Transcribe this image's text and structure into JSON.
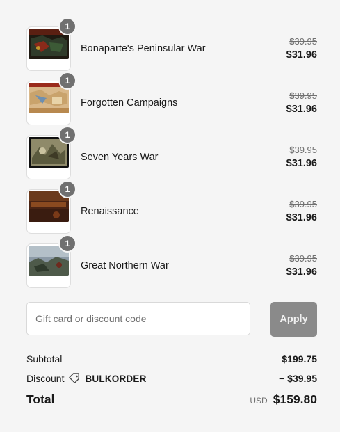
{
  "items": [
    {
      "name": "Bonaparte's Peninsular War",
      "quantity": "1",
      "original_price": "$39.95",
      "price": "$31.96",
      "cover": "cover-peninsular"
    },
    {
      "name": "Forgotten Campaigns",
      "quantity": "1",
      "original_price": "$39.95",
      "price": "$31.96",
      "cover": "cover-forgotten"
    },
    {
      "name": "Seven Years War",
      "quantity": "1",
      "original_price": "$39.95",
      "price": "$31.96",
      "cover": "cover-seven-years"
    },
    {
      "name": "Renaissance",
      "quantity": "1",
      "original_price": "$39.95",
      "price": "$31.96",
      "cover": "cover-renaissance"
    },
    {
      "name": "Great Northern War",
      "quantity": "1",
      "original_price": "$39.95",
      "price": "$31.96",
      "cover": "cover-northern"
    }
  ],
  "discount_form": {
    "placeholder": "Gift card or discount code",
    "value": "",
    "apply_label": "Apply"
  },
  "summary": {
    "subtotal_label": "Subtotal",
    "subtotal_value": "$199.75",
    "discount_label": "Discount",
    "discount_icon": "tag-icon",
    "discount_code": "BULKORDER",
    "discount_value": "− $39.95",
    "total_label": "Total",
    "currency": "USD",
    "total_value": "$159.80"
  },
  "colors": {
    "background": "#f5f5f5",
    "apply_button": "#8a8a8a",
    "badge": "#707070"
  }
}
